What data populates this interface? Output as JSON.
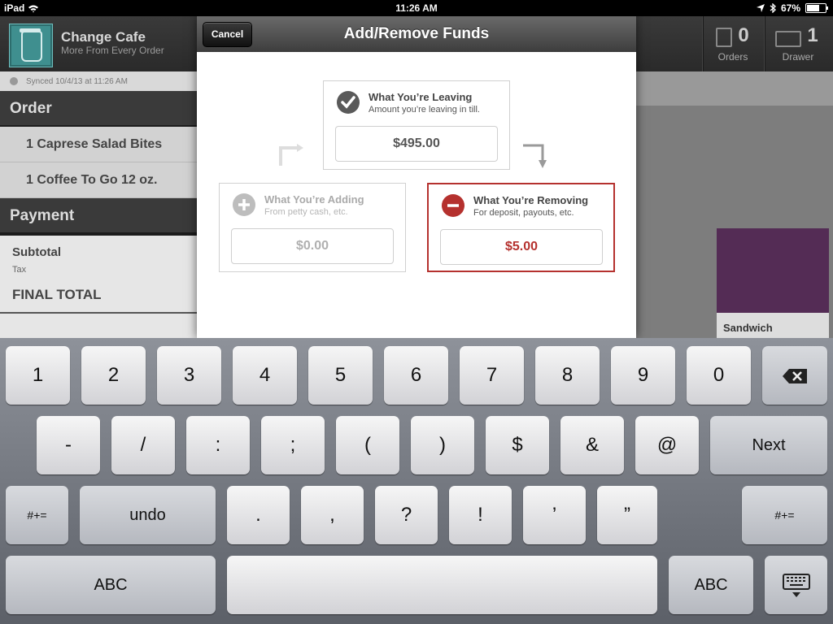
{
  "status_bar": {
    "carrier": "iPad",
    "time": "11:26 AM",
    "battery": "67%",
    "battery_level": 0.67
  },
  "app": {
    "name": "Change Cafe",
    "tagline": "More From Every Order"
  },
  "header_stats": [
    {
      "count": "0",
      "label": "Orders"
    },
    {
      "count": "1",
      "label": "Drawer"
    }
  ],
  "sync_status": "Synced 10/4/13 at 11:26 AM",
  "order": {
    "heading": "Order",
    "items": [
      "1 Caprese Salad Bites",
      "1 Coffee To Go 12 oz."
    ]
  },
  "payment": {
    "heading": "Payment",
    "subtotal_label": "Subtotal",
    "tax_label": "Tax",
    "final_total_label": "FINAL TOTAL"
  },
  "menu_tile": {
    "label": "Sandwich",
    "color": "#542c55"
  },
  "modal": {
    "title": "Add/Remove Funds",
    "cancel_label": "Cancel",
    "leaving": {
      "title": "What You’re Leaving",
      "subtitle": "Amount you’re leaving in till.",
      "value": "$495.00",
      "icon": "checkmark-icon"
    },
    "adding": {
      "title": "What You’re Adding",
      "subtitle": "From petty cash, etc.",
      "value": "$0.00",
      "icon": "plus-icon"
    },
    "removing": {
      "title": "What You’re Removing",
      "subtitle": "For deposit, payouts, etc.",
      "value": "$5.00",
      "icon": "minus-icon"
    },
    "colors": {
      "accent_red": "#b5312e",
      "inactive_gray": "#aaaaaa"
    }
  },
  "keyboard": {
    "row1": [
      "1",
      "2",
      "3",
      "4",
      "5",
      "6",
      "7",
      "8",
      "9",
      "0"
    ],
    "row2": [
      "-",
      "/",
      ":",
      ";",
      "(",
      ")",
      "$",
      "&",
      "@"
    ],
    "row2_next": "Next",
    "row3_shift": "#+=",
    "row3_undo": "undo",
    "row3": [
      ".",
      ",",
      "?",
      "!",
      "’",
      "”"
    ],
    "row3_shift_right": "#+=",
    "row4_abc_left": "ABC",
    "row4_abc_right": "ABC"
  }
}
